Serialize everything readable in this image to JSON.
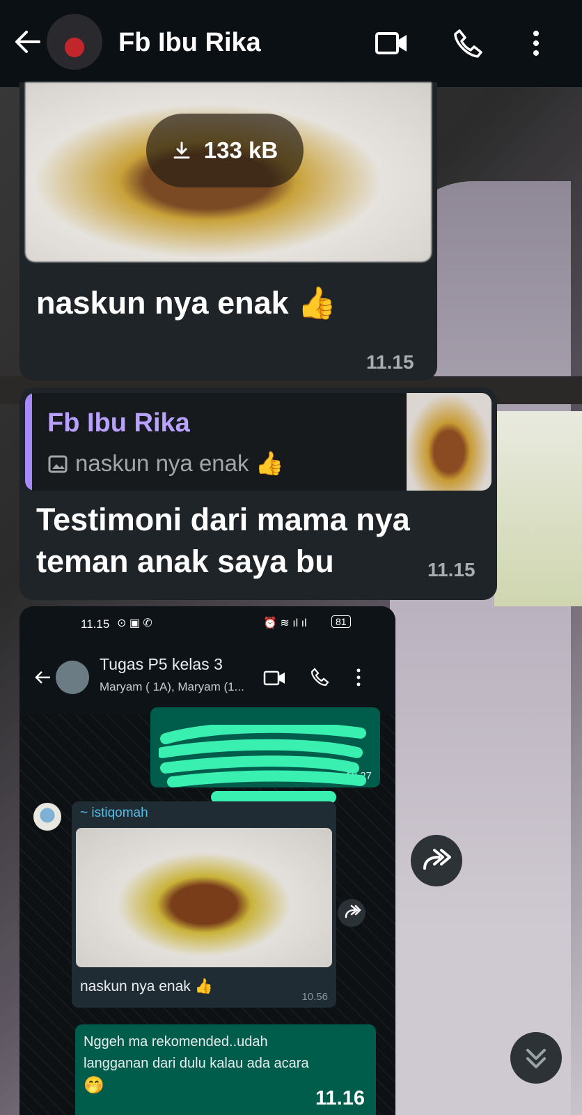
{
  "header": {
    "contact_name": "Fb Ibu Rika",
    "icons": [
      "back-arrow-icon",
      "avatar-car",
      "video-call-icon",
      "voice-call-icon",
      "more-vert-icon"
    ]
  },
  "messages": {
    "image_message": {
      "download_size": "133 kB",
      "caption": "naskun nya enak 👍",
      "time": "11.15"
    },
    "reply_message": {
      "quoted_name": "Fb Ibu Rika",
      "quoted_text": "naskun nya enak 👍",
      "text_line1": "Testimoni dari mama nya",
      "text_line2": "teman anak saya bu",
      "time": "11.15"
    },
    "screenshot_message": {
      "status_time": "11.15",
      "battery": "81",
      "chat_title": "Tugas P5 kelas 3",
      "chat_subtitle": "Maryam ( 1A), Maryam (1...",
      "sent_partial_time": "10.27",
      "sender": "~ istiqomah",
      "caption": "naskun nya enak 👍",
      "caption_time": "10.56",
      "reply_text_line1": "Nggeh ma rekomended..udah",
      "reply_text_line2": "langganan dari dulu kalau ada acara",
      "reply_emoji": "🤭",
      "time": "11.16"
    }
  },
  "colors": {
    "header_bg": "#0b1014",
    "bubble_bg": "#1f2428",
    "quote_accent": "#a78bfa",
    "sent_bubble": "#005c4b"
  }
}
